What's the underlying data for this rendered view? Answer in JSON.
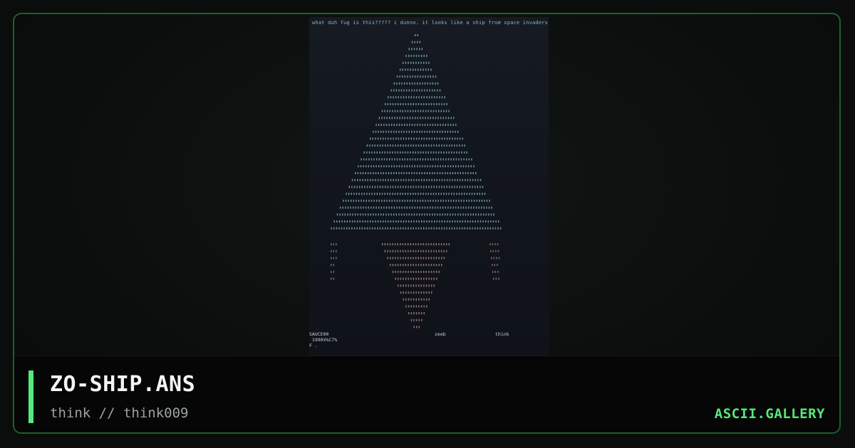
{
  "art": {
    "caption": "what duh fug is this????? i dunno.  it looks like a ship from space invaders.",
    "signature_left": "SAUCE00\n 1990X%C7%\nF .",
    "signature_mid": "zeeb",
    "signature_right": "think"
  },
  "footer": {
    "title": "ZO-SHIP.ANS",
    "subtitle": "think // think009",
    "brand": "ASCII.GALLERY"
  },
  "colors": {
    "accent": "#56e87c",
    "frame_border": "#1f5f2f",
    "art_text_top": "#8fc4d6",
    "art_text_bottom": "#d9a0a8"
  }
}
